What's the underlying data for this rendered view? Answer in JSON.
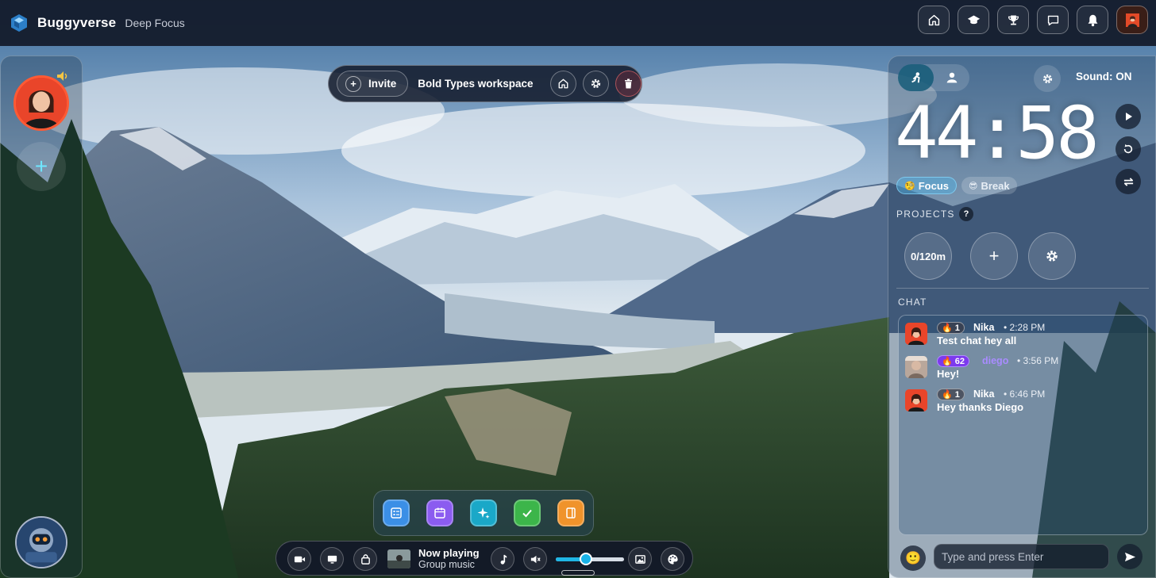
{
  "app": {
    "brand": "Buggyverse",
    "workspace_subtitle": "Deep Focus"
  },
  "topnav": {
    "items": [
      {
        "icon": "home-icon"
      },
      {
        "icon": "graduation-cap-icon"
      },
      {
        "icon": "trophy-icon"
      },
      {
        "icon": "chat-icon"
      },
      {
        "icon": "bell-icon"
      },
      {
        "icon": "user-avatar"
      }
    ]
  },
  "room": {
    "invite_label": "Invite",
    "name": "Bold Types workspace"
  },
  "timer": {
    "display": "44:58",
    "sound_label": "Sound: ON",
    "focus_label": "Focus",
    "break_label": "Break",
    "focus_emoji": "🧐",
    "break_emoji": "😎"
  },
  "projects": {
    "label": "PROJECTS",
    "help": "?",
    "progress": "0/120m"
  },
  "chat": {
    "label": "CHAT",
    "input_placeholder": "Type and press Enter",
    "messages": [
      {
        "streak": "1",
        "user": "Nika",
        "time": "• 2:28 PM",
        "text": "Test chat hey all"
      },
      {
        "streak": "62",
        "user": "diego",
        "time": "• 3:56 PM",
        "text": "Hey!"
      },
      {
        "streak": "1",
        "user": "Nika",
        "time": "• 6:46 PM",
        "text": "Hey thanks Diego"
      }
    ]
  },
  "media": {
    "now_playing_title": "Now playing",
    "now_playing_sub": "Group music",
    "volume_fraction": 0.44
  },
  "colors": {
    "accent": "#1fb6e6",
    "user_highlight": "#a98cff",
    "streak_purple": "#7c3aed"
  }
}
